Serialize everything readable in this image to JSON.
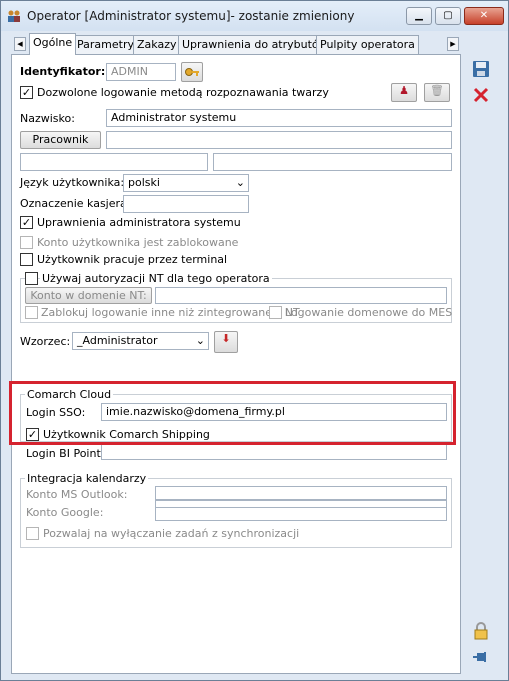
{
  "window": {
    "title": "Operator [Administrator systemu]- zostanie zmieniony",
    "minimize_icon": "minimize-icon",
    "maximize_icon": "maximize-icon",
    "close_icon": "close-icon"
  },
  "tabs": [
    "Ogólne",
    "Parametry",
    "Zakazy",
    "Uprawnienia do atrybutów",
    "Pulpity operatora"
  ],
  "form": {
    "identyfikator_label": "Identyfikator:",
    "identyfikator_value": "ADMIN",
    "face_login_label": "Dozwolone logowanie metodą rozpoznawania twarzy",
    "face_login_checked": true,
    "nazwisko_label": "Nazwisko:",
    "nazwisko_value": "Administrator systemu",
    "pracownik_button": "Pracownik",
    "jezyk_label": "Język użytkownika:",
    "jezyk_value": "polski",
    "kasjer_label": "Oznaczenie kasjera:",
    "admin_rights_label": "Uprawnienia administratora systemu",
    "admin_rights_checked": true,
    "blocked_label": "Konto użytkownika jest zablokowane",
    "terminal_label": "Użytkownik pracuje przez terminal",
    "nt_group_label": "Używaj autoryzacji NT dla tego operatora",
    "nt_domain_button": "Konto w domenie NT:",
    "nt_block_label": "Zablokuj logowanie inne niż zintegrowane z NT",
    "nt_domain_login_label": "Logowanie domenowe do MES",
    "wzorzec_label": "Wzorzec:",
    "wzorzec_value": "_Administrator"
  },
  "cloud": {
    "title": "Comarch Cloud",
    "login_sso_label": "Login SSO:",
    "login_sso_value": "imie.nazwisko@domena_firmy.pl",
    "shipping_label": "Użytkownik Comarch Shipping",
    "shipping_checked": true,
    "bi_label": "Login BI Point:",
    "bi_value": ""
  },
  "calendar": {
    "title": "Integracja kalendarzy",
    "outlook_label": "Konto MS Outlook:",
    "google_label": "Konto Google:",
    "sync_label": "Pozwalaj na wyłączanie zadań z synchronizacji"
  },
  "colors": {
    "highlight": "#d5232f",
    "accent": "#3a6ea5"
  }
}
